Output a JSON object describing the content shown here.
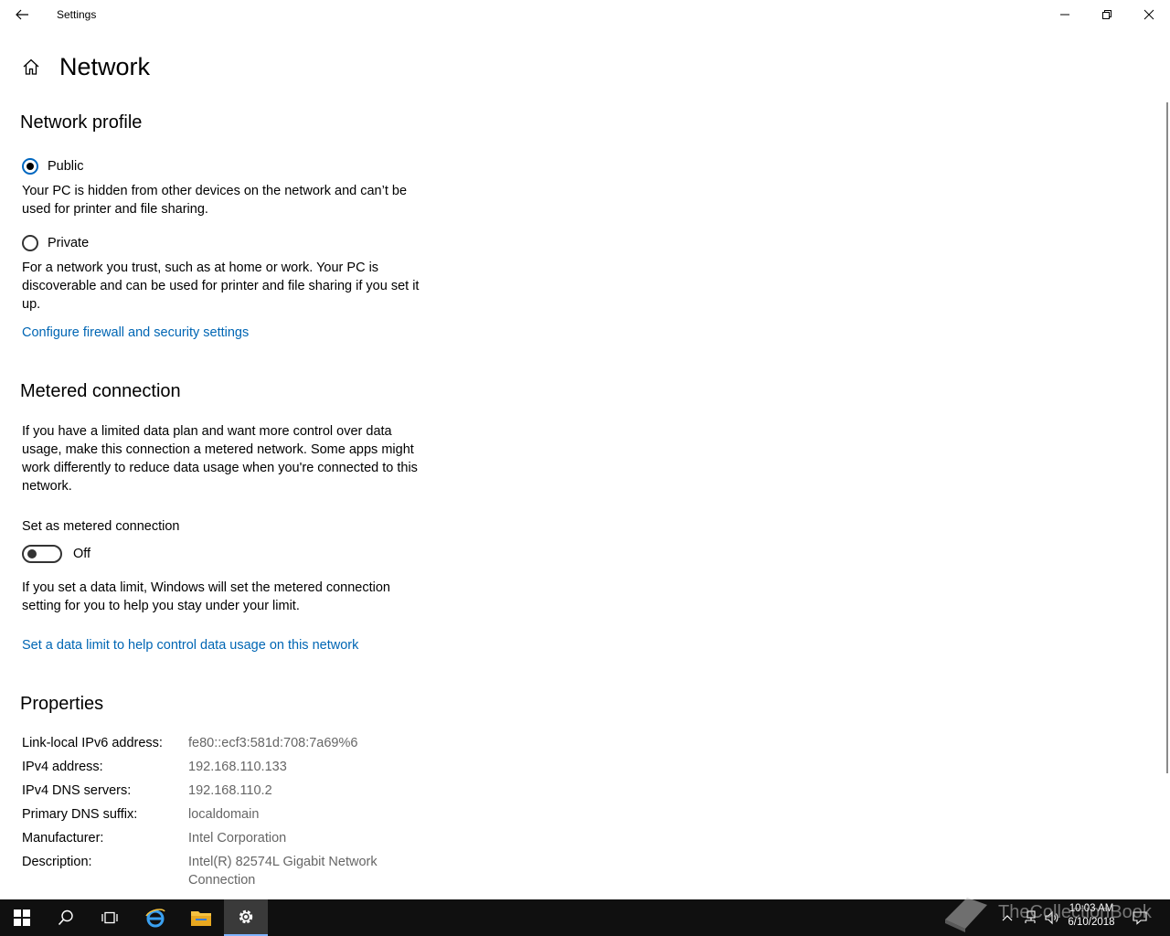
{
  "window": {
    "title": "Settings"
  },
  "page": {
    "title": "Network"
  },
  "network_profile": {
    "heading": "Network profile",
    "options": [
      {
        "label": "Public",
        "checked": true,
        "description": "Your PC is hidden from other devices on the network and can’t be used for printer and file sharing."
      },
      {
        "label": "Private",
        "checked": false,
        "description": "For a network you trust, such as at home or work. Your PC is discoverable and can be used for printer and file sharing if you set it up."
      }
    ],
    "firewall_link": "Configure firewall and security settings"
  },
  "metered": {
    "heading": "Metered connection",
    "description": "If you have a limited data plan and want more control over data usage, make this connection a metered network. Some apps might work differently to reduce data usage when you're connected to this network.",
    "toggle_label": "Set as metered connection",
    "toggle_state": "Off",
    "limit_note": "If you set a data limit, Windows will set the metered connection setting for you to help you stay under your limit.",
    "data_limit_link": "Set a data limit to help control data usage on this network"
  },
  "properties": {
    "heading": "Properties",
    "rows": [
      {
        "label": "Link-local IPv6 address:",
        "value": "fe80::ecf3:581d:708:7a69%6"
      },
      {
        "label": "IPv4 address:",
        "value": "192.168.110.133"
      },
      {
        "label": "IPv4 DNS servers:",
        "value": "192.168.110.2"
      },
      {
        "label": "Primary DNS suffix:",
        "value": "localdomain"
      },
      {
        "label": "Manufacturer:",
        "value": "Intel Corporation"
      },
      {
        "label": "Description:",
        "value": "Intel(R) 82574L Gigabit Network Connection"
      }
    ]
  },
  "taskbar": {
    "time": "10:03 AM",
    "date": "6/10/2018",
    "watermark": "TheCollectionBook",
    "accent_color": "#7fb3ff"
  },
  "colors": {
    "link": "#0066b4",
    "radio_accent": "#0067c0",
    "taskbar_bg": "#101010"
  }
}
